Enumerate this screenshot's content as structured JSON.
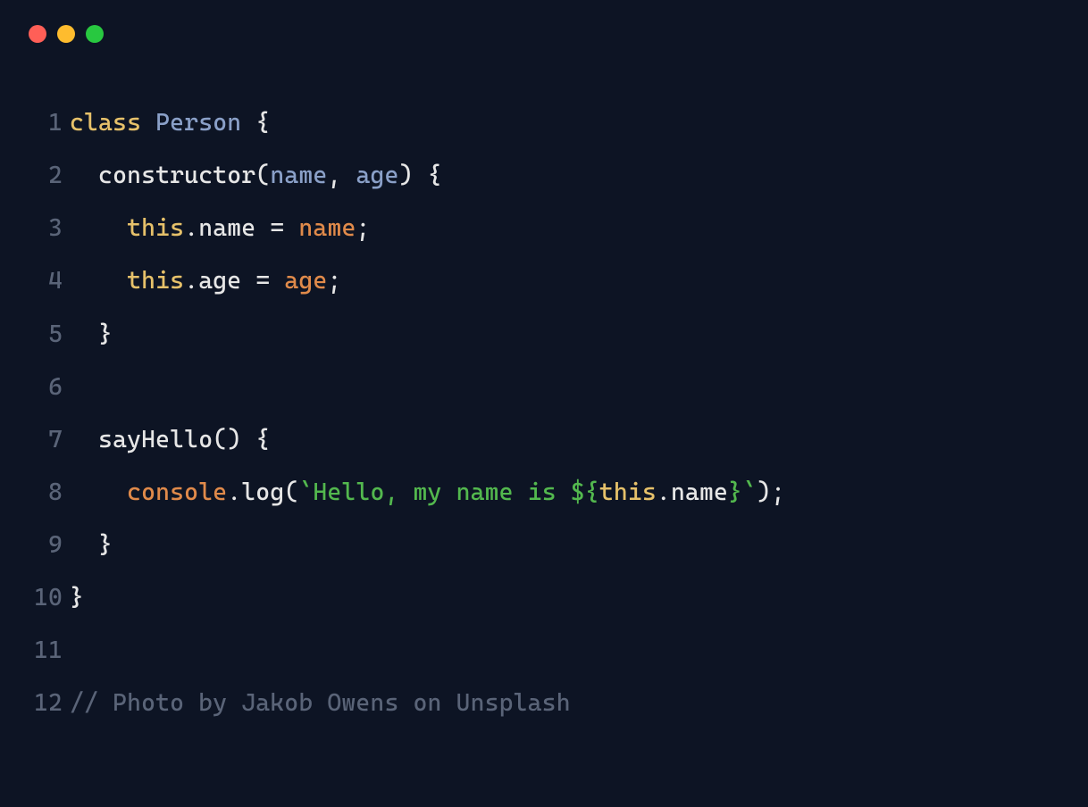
{
  "window": {
    "traffic_light_colors": {
      "close": "#ff5f57",
      "minimize": "#febc2e",
      "zoom": "#28c840"
    }
  },
  "code": {
    "lines": [
      {
        "num": "1",
        "tokens": [
          {
            "cls": "tk-keyword",
            "t": "class"
          },
          {
            "cls": "tk-default",
            "t": " "
          },
          {
            "cls": "tk-classname",
            "t": "Person"
          },
          {
            "cls": "tk-default",
            "t": " "
          },
          {
            "cls": "tk-punct",
            "t": "{"
          }
        ]
      },
      {
        "num": "2",
        "tokens": [
          {
            "cls": "tk-default",
            "t": "  "
          },
          {
            "cls": "tk-default",
            "t": "constructor"
          },
          {
            "cls": "tk-punct",
            "t": "("
          },
          {
            "cls": "tk-param",
            "t": "name"
          },
          {
            "cls": "tk-punct",
            "t": ","
          },
          {
            "cls": "tk-default",
            "t": " "
          },
          {
            "cls": "tk-param",
            "t": "age"
          },
          {
            "cls": "tk-punct",
            "t": ")"
          },
          {
            "cls": "tk-default",
            "t": " "
          },
          {
            "cls": "tk-punct",
            "t": "{"
          }
        ]
      },
      {
        "num": "3",
        "tokens": [
          {
            "cls": "tk-default",
            "t": "    "
          },
          {
            "cls": "tk-this",
            "t": "this"
          },
          {
            "cls": "tk-punct",
            "t": "."
          },
          {
            "cls": "tk-propname",
            "t": "name"
          },
          {
            "cls": "tk-default",
            "t": " "
          },
          {
            "cls": "tk-operator",
            "t": "="
          },
          {
            "cls": "tk-default",
            "t": " "
          },
          {
            "cls": "tk-variable",
            "t": "name"
          },
          {
            "cls": "tk-punct",
            "t": ";"
          }
        ]
      },
      {
        "num": "4",
        "tokens": [
          {
            "cls": "tk-default",
            "t": "    "
          },
          {
            "cls": "tk-this",
            "t": "this"
          },
          {
            "cls": "tk-punct",
            "t": "."
          },
          {
            "cls": "tk-propname",
            "t": "age"
          },
          {
            "cls": "tk-default",
            "t": " "
          },
          {
            "cls": "tk-operator",
            "t": "="
          },
          {
            "cls": "tk-default",
            "t": " "
          },
          {
            "cls": "tk-variable",
            "t": "age"
          },
          {
            "cls": "tk-punct",
            "t": ";"
          }
        ]
      },
      {
        "num": "5",
        "tokens": [
          {
            "cls": "tk-default",
            "t": "  "
          },
          {
            "cls": "tk-punct",
            "t": "}"
          }
        ]
      },
      {
        "num": "6",
        "tokens": [
          {
            "cls": "tk-default",
            "t": ""
          }
        ]
      },
      {
        "num": "7",
        "tokens": [
          {
            "cls": "tk-default",
            "t": "  "
          },
          {
            "cls": "tk-default",
            "t": "sayHello"
          },
          {
            "cls": "tk-punct",
            "t": "()"
          },
          {
            "cls": "tk-default",
            "t": " "
          },
          {
            "cls": "tk-punct",
            "t": "{"
          }
        ]
      },
      {
        "num": "8",
        "tokens": [
          {
            "cls": "tk-default",
            "t": "    "
          },
          {
            "cls": "tk-console",
            "t": "console"
          },
          {
            "cls": "tk-punct",
            "t": "."
          },
          {
            "cls": "tk-default",
            "t": "log"
          },
          {
            "cls": "tk-punct",
            "t": "("
          },
          {
            "cls": "tk-string",
            "t": "`Hello, my name is "
          },
          {
            "cls": "tk-interp",
            "t": "${"
          },
          {
            "cls": "tk-this",
            "t": "this"
          },
          {
            "cls": "tk-punct",
            "t": "."
          },
          {
            "cls": "tk-default",
            "t": "name"
          },
          {
            "cls": "tk-interp",
            "t": "}"
          },
          {
            "cls": "tk-string",
            "t": "`"
          },
          {
            "cls": "tk-punct",
            "t": ");"
          }
        ]
      },
      {
        "num": "9",
        "tokens": [
          {
            "cls": "tk-default",
            "t": "  "
          },
          {
            "cls": "tk-punct",
            "t": "}"
          }
        ]
      },
      {
        "num": "10",
        "tokens": [
          {
            "cls": "tk-punct",
            "t": "}"
          }
        ]
      },
      {
        "num": "11",
        "tokens": [
          {
            "cls": "tk-default",
            "t": ""
          }
        ]
      },
      {
        "num": "12",
        "tokens": [
          {
            "cls": "tk-comment",
            "t": "// Photo by Jakob Owens on Unsplash"
          }
        ]
      }
    ]
  }
}
